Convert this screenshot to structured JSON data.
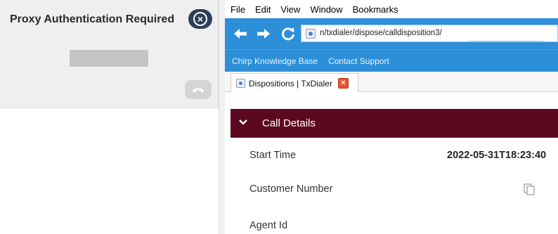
{
  "proxy_panel": {
    "title": "Proxy Authentication Required"
  },
  "browser": {
    "menu": [
      "File",
      "Edit",
      "View",
      "Window",
      "Bookmarks"
    ],
    "url": "n/txdialer/dispose/calldisposition3/",
    "bookmarks": [
      "Chirp Knowledge Base",
      "Contact Support"
    ],
    "tab": {
      "title": "Dispositions | TxDialer"
    }
  },
  "call_details": {
    "section_title": "Call Details",
    "rows": [
      {
        "label": "Start Time",
        "value": "2022-05-31T18:23:40"
      },
      {
        "label": "Customer Number",
        "value": ""
      },
      {
        "label": "Agent Id",
        "value": ""
      }
    ]
  },
  "colors": {
    "toolbar_blue": "#2c8fd8",
    "section_header": "#5c0820",
    "proxy_close_button": "#2d3e57",
    "tab_close": "#e4572e"
  },
  "icons": {
    "proxy_close": "close-icon",
    "hangup": "phone-hangup-icon",
    "back": "arrow-left-icon",
    "forward": "arrow-right-icon",
    "reload": "reload-icon",
    "page": "page-icon",
    "tab_close": "close-icon",
    "section_toggle": "chevron-down-icon",
    "copy": "copy-icon"
  }
}
